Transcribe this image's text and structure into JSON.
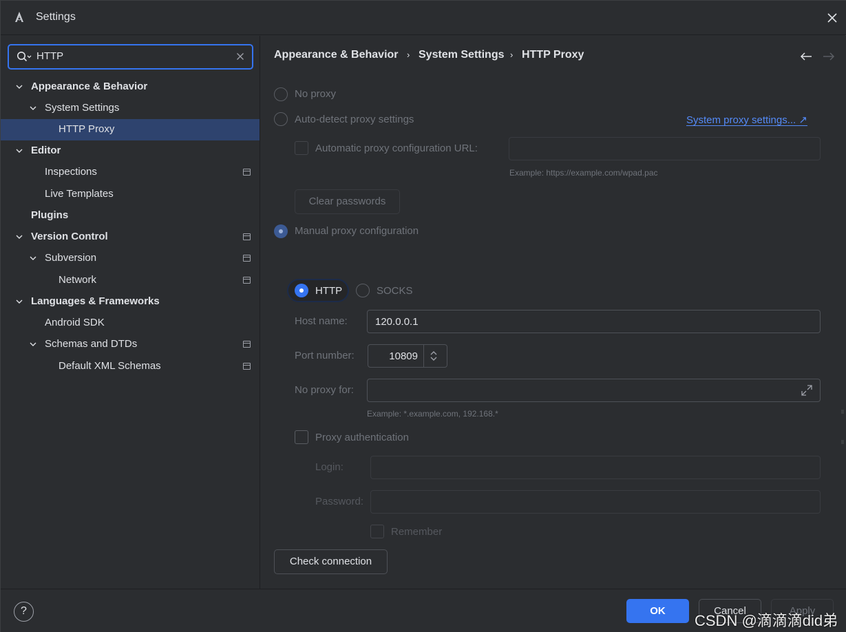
{
  "window": {
    "title": "Settings"
  },
  "search": {
    "value": "HTTP"
  },
  "tree": [
    {
      "label": "Appearance & Behavior",
      "bold": true,
      "expanded": true,
      "level": 0
    },
    {
      "label": "System Settings",
      "bold": false,
      "expanded": true,
      "level": 1
    },
    {
      "label": "HTTP Proxy",
      "bold": false,
      "level": 2,
      "selected": true
    },
    {
      "label": "Editor",
      "bold": true,
      "expanded": true,
      "level": 0
    },
    {
      "label": "Inspections",
      "bold": false,
      "level": 1,
      "project_level": true
    },
    {
      "label": "Live Templates",
      "bold": false,
      "level": 1
    },
    {
      "label": "Plugins",
      "bold": true,
      "level": 0
    },
    {
      "label": "Version Control",
      "bold": true,
      "expanded": true,
      "level": 0,
      "project_level": true
    },
    {
      "label": "Subversion",
      "bold": false,
      "expanded": true,
      "level": 1,
      "project_level": true
    },
    {
      "label": "Network",
      "bold": false,
      "level": 2,
      "project_level": true
    },
    {
      "label": "Languages & Frameworks",
      "bold": true,
      "expanded": true,
      "level": 0
    },
    {
      "label": "Android SDK",
      "bold": false,
      "level": 1
    },
    {
      "label": "Schemas and DTDs",
      "bold": false,
      "expanded": true,
      "level": 1,
      "project_level": true
    },
    {
      "label": "Default XML Schemas",
      "bold": false,
      "level": 2,
      "project_level": true
    }
  ],
  "breadcrumb": {
    "items": [
      "Appearance & Behavior",
      "System Settings",
      "HTTP Proxy"
    ],
    "separator": "›"
  },
  "proxy": {
    "no_proxy_label": "No proxy",
    "auto_detect_label": "Auto-detect proxy settings",
    "system_proxy_link": "System proxy settings... ↗",
    "auto_config_url_label": "Automatic proxy configuration URL:",
    "auto_config_url_value": "",
    "auto_config_example": "Example: https://example.com/wpad.pac",
    "clear_passwords_label": "Clear passwords",
    "manual_label": "Manual proxy configuration",
    "selected_mode": "manual",
    "http_label": "HTTP",
    "socks_label": "SOCKS",
    "selected_type": "HTTP",
    "host_label": "Host name:",
    "host_value": "120.0.0.1",
    "port_label": "Port number:",
    "port_value": "10809",
    "no_proxy_for_label": "No proxy for:",
    "no_proxy_for_value": "",
    "no_proxy_example": "Example: *.example.com, 192.168.*",
    "auth_label": "Proxy authentication",
    "auth_checked": false,
    "login_label": "Login:",
    "login_value": "",
    "password_label": "Password:",
    "password_value": "",
    "remember_label": "Remember",
    "check_connection_label": "Check connection"
  },
  "footer": {
    "help_label": "?",
    "ok_label": "OK",
    "cancel_label": "Cancel",
    "apply_label": "Apply",
    "watermark": "CSDN @滴滴滴did弟"
  },
  "colors": {
    "accent": "#3574f0",
    "link": "#548af7",
    "selection": "#2e436e",
    "background": "#2b2d30"
  }
}
